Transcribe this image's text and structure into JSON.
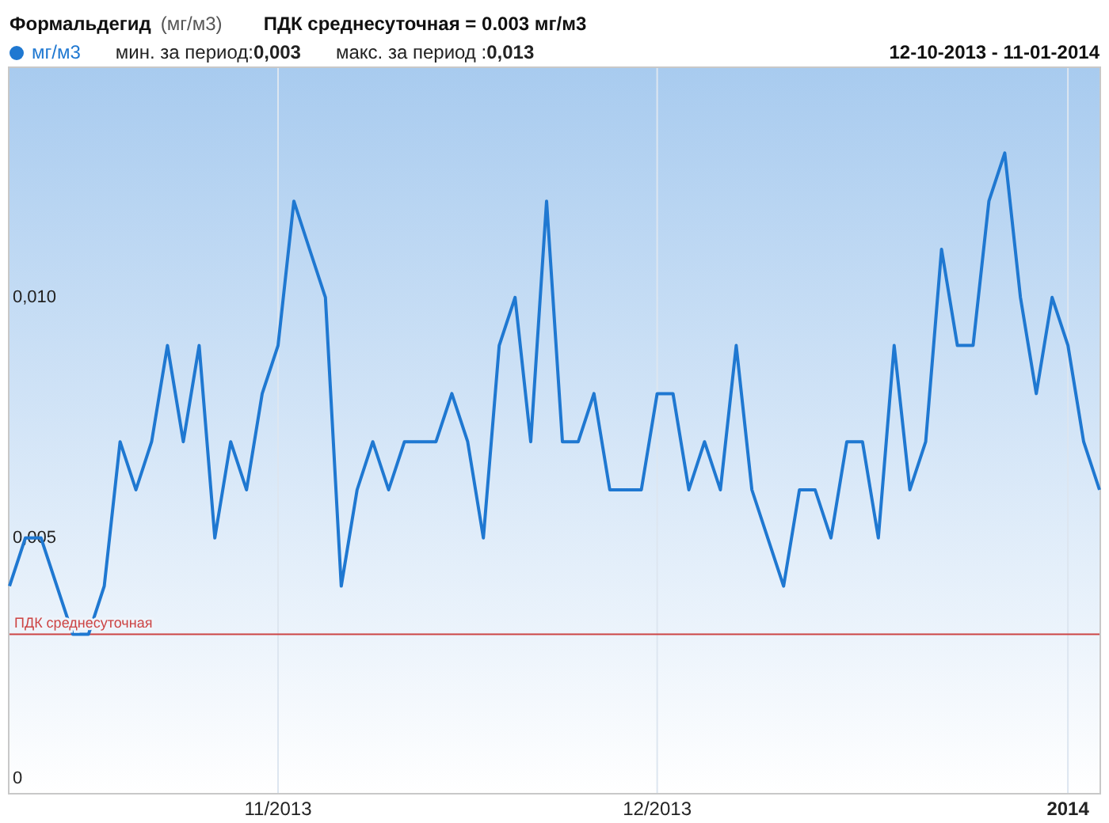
{
  "header": {
    "title": "Формальдегид",
    "unit": "(мг/м3)",
    "limit_note": "ПДК среднесуточная = 0.003 мг/м3"
  },
  "legend": {
    "min": "мин. за период:**0,003**",
    "max": "макс. за период :**0,013**",
    "range": "12-10-2013 - 11-01-2014"
  },
  "chart": {
    "chart_data": {
      "type": "line",
      "categories": [
        null,
        null,
        null,
        null,
        null,
        null,
        null,
        null,
        null,
        null,
        null,
        null,
        null,
        null,
        null,
        null,
        null,
        "11/2013",
        null,
        null,
        null,
        null,
        null,
        null,
        null,
        null,
        null,
        null,
        null,
        null,
        null,
        null,
        null,
        null,
        null,
        null,
        null,
        null,
        null,
        null,
        null,
        "12/2013",
        null,
        null,
        null,
        null,
        null,
        null,
        null,
        null,
        null,
        null,
        null,
        null,
        null,
        null,
        null,
        null,
        null,
        null,
        null,
        null,
        null,
        null,
        null,
        null,
        null,
        "2014",
        null,
        null
      ],
      "series": [
        {
          "name": "мг/м3",
          "color": "#1f78d1",
          "values": [
            0.004,
            0.005,
            0.005,
            0.004,
            0.003,
            0.003,
            0.004,
            0.007,
            0.006,
            0.007,
            0.009,
            0.007,
            0.009,
            0.005,
            0.007,
            0.006,
            0.008,
            0.009,
            0.012,
            0.011,
            0.01,
            0.004,
            0.006,
            0.007,
            0.006,
            0.007,
            0.007,
            0.007,
            0.008,
            0.007,
            0.005,
            0.009,
            0.01,
            0.007,
            0.012,
            0.007,
            0.007,
            0.008,
            0.006,
            0.006,
            0.006,
            0.008,
            0.008,
            0.006,
            0.007,
            0.006,
            0.009,
            0.006,
            0.005,
            0.004,
            0.006,
            0.006,
            0.005,
            0.007,
            0.007,
            0.005,
            0.009,
            0.006,
            0.007,
            0.011,
            0.009,
            0.009,
            0.012,
            0.013,
            0.01,
            0.008,
            0.01,
            0.009,
            0.007,
            0.006
          ]
        }
      ],
      "ylim": [
        -0.0003,
        0.0148
      ],
      "yticks": [
        {
          "value": 0,
          "label": "0"
        },
        {
          "value": 0.005,
          "label": "0,005"
        },
        {
          "value": 0.01,
          "label": "0,010"
        }
      ],
      "grid": true,
      "ref_lines": [
        {
          "axis": "y",
          "value": 0.003,
          "label": "ПДК среднесуточная",
          "color": "#cc4444"
        }
      ]
    }
  }
}
